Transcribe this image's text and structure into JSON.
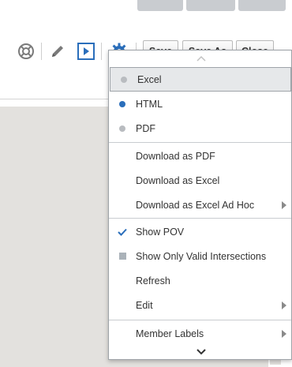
{
  "toolbar": {
    "icons": [
      "lifebuoy-icon",
      "pencil-icon",
      "run-icon",
      "gear-icon"
    ],
    "save_label": "Save",
    "save_as_label": "Save As",
    "close_label": "Close",
    "colors": {
      "run": "#2a6ebb",
      "gear": "#2a6ebb",
      "icon_grey": "#7a7a7a"
    }
  },
  "menu": {
    "scroll_up_icon": "chevron-up-icon",
    "scroll_down_icon": "chevron-down-icon",
    "format_options": [
      {
        "label": "Excel",
        "icon": "radio-dot-icon",
        "selected": true,
        "color": "#b9bcc0"
      },
      {
        "label": "HTML",
        "icon": "radio-dot-icon",
        "selected": false,
        "color": "#2a6ebb"
      },
      {
        "label": "PDF",
        "icon": "radio-dot-icon",
        "selected": false,
        "color": "#b9bcc0"
      }
    ],
    "download_options": [
      {
        "label": "Download as PDF"
      },
      {
        "label": "Download as Excel"
      },
      {
        "label": "Download as Excel Ad Hoc",
        "submenu": true
      }
    ],
    "view_options": [
      {
        "label": "Show POV",
        "icon": "checkmark-icon",
        "checked": true
      },
      {
        "label": "Show Only Valid Intersections",
        "icon": "checkbox-square-icon",
        "checked": false
      },
      {
        "label": "Refresh"
      },
      {
        "label": "Edit",
        "submenu": true
      }
    ],
    "label_options": [
      {
        "label": "Member Labels",
        "submenu": true
      }
    ]
  }
}
